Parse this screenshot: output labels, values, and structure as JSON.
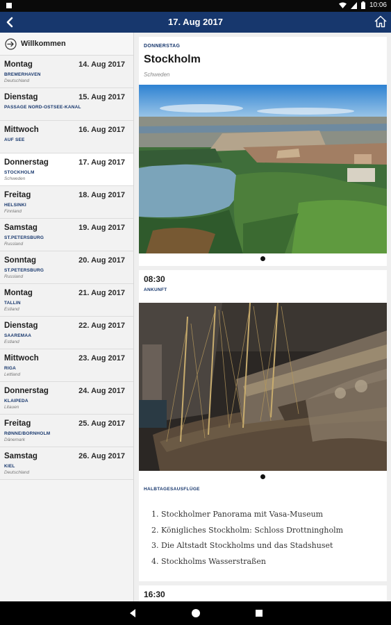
{
  "status_bar": {
    "time": "10:06"
  },
  "app_bar": {
    "title": "17. Aug 2017"
  },
  "sidebar": {
    "welcome_label": "Willkommen",
    "days": [
      {
        "weekday": "Montag",
        "date": "14. Aug 2017",
        "port": "BREMERHAVEN",
        "country": "Deutschland",
        "active": false
      },
      {
        "weekday": "Dienstag",
        "date": "15. Aug 2017",
        "port": "PASSAGE NORD-OSTSEE-KANAL",
        "country": "",
        "active": false
      },
      {
        "weekday": "Mittwoch",
        "date": "16. Aug 2017",
        "port": "AUF SEE",
        "country": "",
        "active": false
      },
      {
        "weekday": "Donnerstag",
        "date": "17. Aug 2017",
        "port": "STOCKHOLM",
        "country": "Schweden",
        "active": true
      },
      {
        "weekday": "Freitag",
        "date": "18. Aug 2017",
        "port": "HELSINKI",
        "country": "Finnland",
        "active": false
      },
      {
        "weekday": "Samstag",
        "date": "19. Aug 2017",
        "port": "ST.PETERSBURG",
        "country": "Russland",
        "active": false
      },
      {
        "weekday": "Sonntag",
        "date": "20. Aug 2017",
        "port": "ST.PETERSBURG",
        "country": "Russland",
        "active": false
      },
      {
        "weekday": "Montag",
        "date": "21. Aug 2017",
        "port": "TALLIN",
        "country": "Estland",
        "active": false
      },
      {
        "weekday": "Dienstag",
        "date": "22. Aug 2017",
        "port": "SAAREMAA",
        "country": "Estland",
        "active": false
      },
      {
        "weekday": "Mittwoch",
        "date": "23. Aug 2017",
        "port": "RIGA",
        "country": "Lettland",
        "active": false
      },
      {
        "weekday": "Donnerstag",
        "date": "24. Aug 2017",
        "port": "KLAIPEDA",
        "country": "Litauen",
        "active": false
      },
      {
        "weekday": "Freitag",
        "date": "25. Aug 2017",
        "port": "RØNNE/BORNHOLM",
        "country": "Dänemark",
        "active": false
      },
      {
        "weekday": "Samstag",
        "date": "26. Aug 2017",
        "port": "KIEL",
        "country": "Deutschland",
        "active": false
      }
    ]
  },
  "detail": {
    "weekday": "DONNERSTAG",
    "city": "Stockholm",
    "country": "Schweden",
    "arrival_time": "08:30",
    "arrival_label": "ANKUNFT",
    "excursions_label": "HALBTAGESAUSFLÜGE",
    "excursions": [
      "Stockholmer Panorama mit Vasa-Museum",
      "Königliches Stockholm: Schloss Drottningholm",
      "Die Altstadt Stockholms und das Stadshuset",
      "Stockholms Wasserstraßen"
    ],
    "next_time": "16:30"
  },
  "colors": {
    "primary": "#17376d",
    "status_bar": "#0a0a0a",
    "nav_bar": "#000000"
  },
  "icons": {
    "back": "back-arrow-icon",
    "home": "home-icon",
    "welcome": "arrow-circle-icon"
  }
}
